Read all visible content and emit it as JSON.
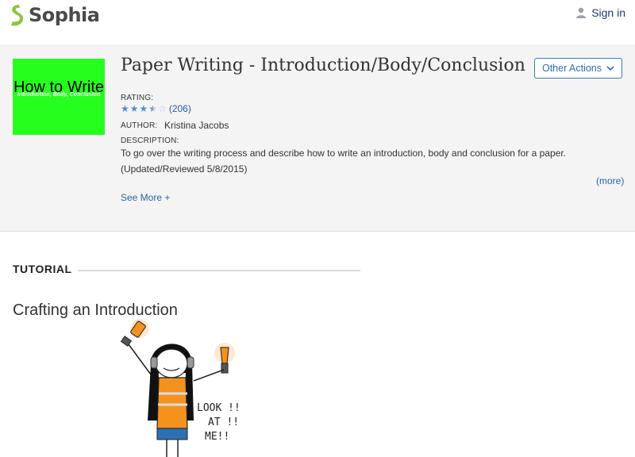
{
  "header": {
    "brand": "Sophia",
    "signin_label": "Sign in"
  },
  "resource": {
    "thumbnail_title": "How to Write",
    "thumbnail_subtitle": "Introduction, Body, Conclusion",
    "title": "Paper Writing - Introduction/Body/Conclusion",
    "other_actions_label": "Other Actions",
    "rating_label": "RATING:",
    "rating_stars": 3.5,
    "rating_count": "(206)",
    "author_label": "AUTHOR:",
    "author": "Kristina Jacobs",
    "description_label": "DESCRIPTION:",
    "description_line1": "To go over the writing process and describe how to write an introduction, body and conclusion for a paper.",
    "description_line2": "(Updated/Reviewed 5/8/2015)",
    "more_label": "(more)",
    "see_more_label": "See More +"
  },
  "content": {
    "section_label": "TUTORIAL",
    "heading": "Crafting an Introduction",
    "illustration_text": [
      "LOOK !!",
      "AT !!",
      "ME!!"
    ]
  },
  "colors": {
    "accent": "#2f6fb5",
    "brand_green": "#8cc63f",
    "thumbnail_bg": "#26ff1d"
  }
}
